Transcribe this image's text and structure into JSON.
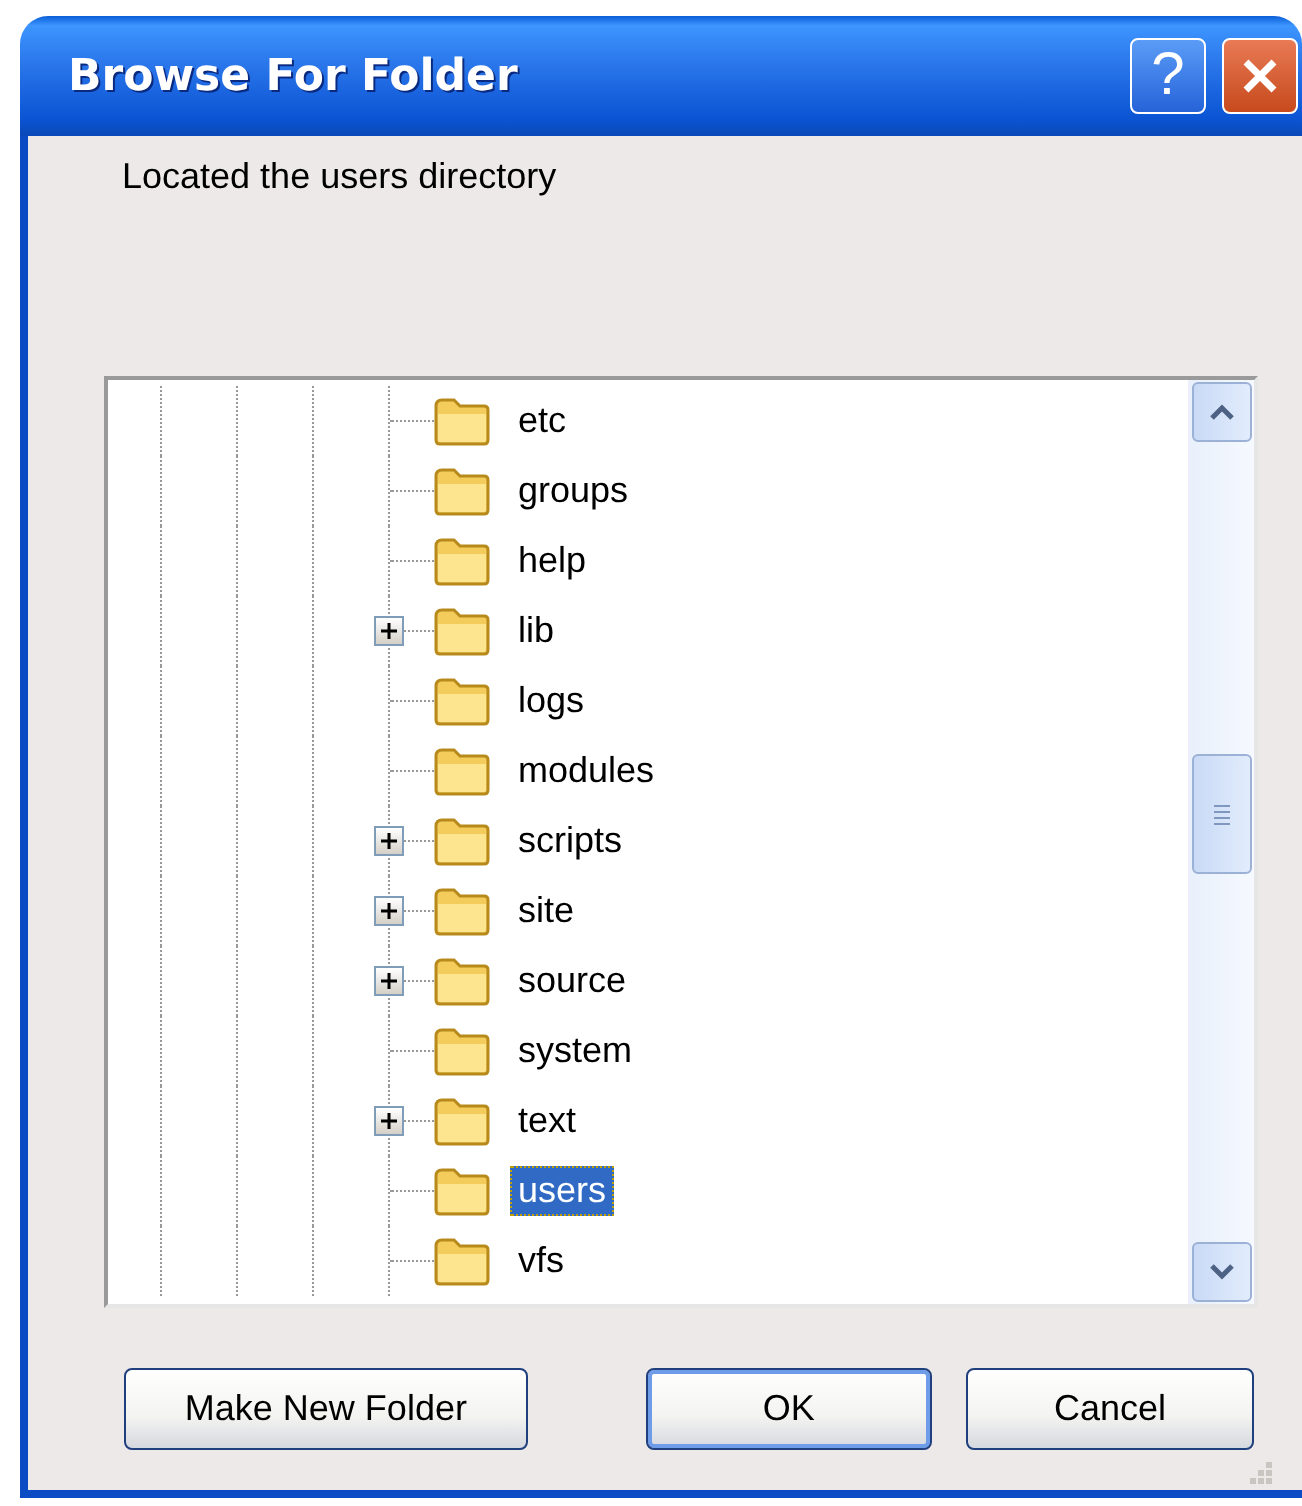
{
  "window": {
    "title": "Browse For Folder",
    "help_label": "?"
  },
  "description": "Located the users directory",
  "tree": {
    "items": [
      {
        "label": "etc",
        "expandable": false,
        "selected": false
      },
      {
        "label": "groups",
        "expandable": false,
        "selected": false
      },
      {
        "label": "help",
        "expandable": false,
        "selected": false
      },
      {
        "label": "lib",
        "expandable": true,
        "selected": false
      },
      {
        "label": "logs",
        "expandable": false,
        "selected": false
      },
      {
        "label": "modules",
        "expandable": false,
        "selected": false
      },
      {
        "label": "scripts",
        "expandable": true,
        "selected": false
      },
      {
        "label": "site",
        "expandable": true,
        "selected": false
      },
      {
        "label": "source",
        "expandable": true,
        "selected": false
      },
      {
        "label": "system",
        "expandable": false,
        "selected": false
      },
      {
        "label": "text",
        "expandable": true,
        "selected": false
      },
      {
        "label": "users",
        "expandable": false,
        "selected": true
      },
      {
        "label": "vfs",
        "expandable": false,
        "selected": false
      }
    ]
  },
  "buttons": [
    {
      "label": "Make New Folder",
      "default": false
    },
    {
      "label": "OK",
      "default": true
    },
    {
      "label": "Cancel",
      "default": false
    }
  ]
}
